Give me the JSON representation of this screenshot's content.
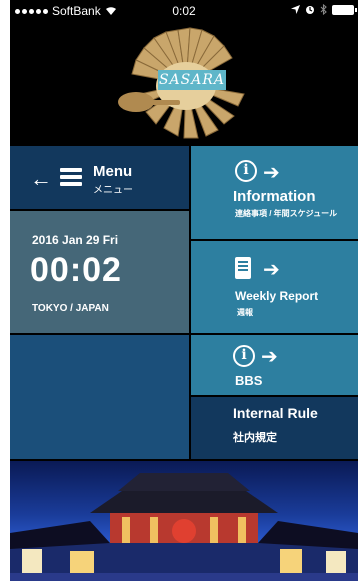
{
  "status_bar": {
    "carrier": "SoftBank",
    "time": "0:02"
  },
  "header": {
    "logo_text": "SASARA"
  },
  "menu_tile": {
    "label": "Menu",
    "sublabel": "メニュー"
  },
  "clock_tile": {
    "date": "2016 Jan 29 Fri",
    "time": "00:02",
    "location": "TOKYO / JAPAN"
  },
  "info_tile": {
    "title": "Information",
    "subtitle": "連絡事項 / 年間スケジュール"
  },
  "weekly_tile": {
    "title": "Weekly Report",
    "subtitle": "週報"
  },
  "bbs_tile": {
    "title": "BBS"
  },
  "rule_tile": {
    "title": "Internal Rule",
    "subtitle": "社内規定"
  },
  "icons": [
    "signal-dots-icon",
    "wifi-icon",
    "location-arrow-icon",
    "alarm-icon",
    "bluetooth-icon",
    "battery-icon",
    "back-arrow-icon",
    "hamburger-icon",
    "info-circle-icon",
    "chevron-right-icon",
    "report-document-icon"
  ],
  "colors": {
    "navy": "#12385d",
    "teal": "#2d7fa0",
    "slate": "#456778",
    "blue": "#1b4f7a"
  }
}
